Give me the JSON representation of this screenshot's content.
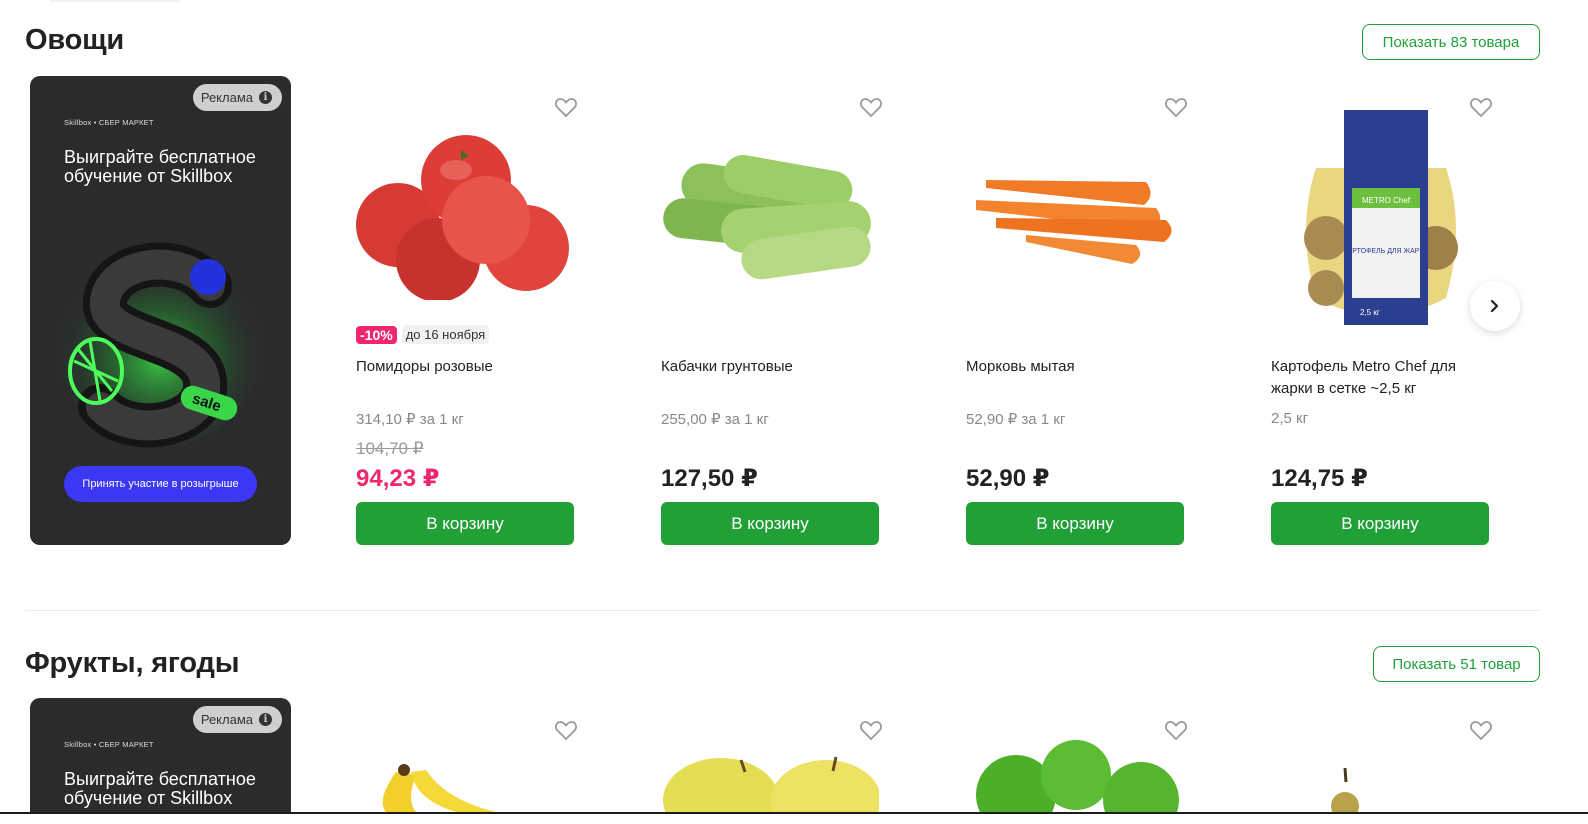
{
  "sections": [
    {
      "title": "Овощи",
      "show_all": "Показать 83 товара",
      "ad": {
        "badge": "Реклама",
        "info": "i",
        "brand": "Skillbox • СБЕР МАРКЕТ",
        "headline": "Выиграйте бесплатное обучение от Skillbox",
        "sticker": "sale",
        "cta": "Принять участие в розыгрыше"
      },
      "products": [
        {
          "name": "Помидоры розовые",
          "discount": "-10%",
          "until": "до 16 ноября",
          "unit_price": "314,10 ₽ за 1 кг",
          "old_price": "104,70 ₽",
          "price": "94,23 ₽",
          "cart": "В корзину"
        },
        {
          "name": "Кабачки грунтовые",
          "unit_price": "255,00 ₽ за 1 кг",
          "price": "127,50 ₽",
          "cart": "В корзину"
        },
        {
          "name": "Морковь мытая",
          "unit_price": "52,90 ₽ за 1 кг",
          "price": "52,90 ₽",
          "cart": "В корзину"
        },
        {
          "name": "Картофель Metro Chef для жарки в сетке ~2,5 кг",
          "unit_price": "2,5 кг",
          "price": "124,75 ₽",
          "cart": "В корзину",
          "pack_brand": "METRO Chef",
          "pack_label": "КАРТОФЕЛЬ ДЛЯ ЖАРКИ",
          "pack_weight": "2,5 кг"
        }
      ]
    },
    {
      "title": "Фрукты, ягоды",
      "show_all": "Показать 51 товар",
      "ad": {
        "badge": "Реклама",
        "info": "i",
        "brand": "Skillbox • СБЕР МАРКЕТ",
        "headline": "Выиграйте бесплатное обучение от Skillbox"
      }
    }
  ],
  "icons": {
    "favorite": "heart-icon",
    "next": "chevron-right-icon"
  },
  "colors": {
    "accent": "#21a038",
    "sale": "#f0266f",
    "ad_bg": "#2b2b2d",
    "ad_cta": "#3b37f5"
  }
}
